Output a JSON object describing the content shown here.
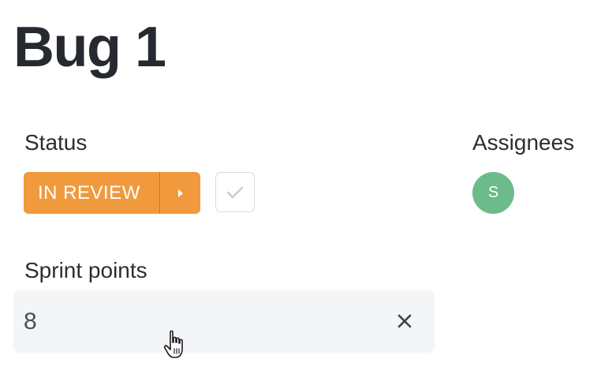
{
  "title": "Bug 1",
  "status": {
    "label": "Status",
    "value": "IN REVIEW",
    "color": "#f19a3d"
  },
  "assignees": {
    "label": "Assignees",
    "avatars": [
      {
        "initial": "S",
        "color": "#6bbb8b"
      }
    ]
  },
  "sprint_points": {
    "label": "Sprint points",
    "value": "8"
  },
  "icons": {
    "status_next": "caret-right-icon",
    "complete": "check-icon",
    "clear": "close-icon",
    "cursor": "hand-pointer-cursor"
  }
}
